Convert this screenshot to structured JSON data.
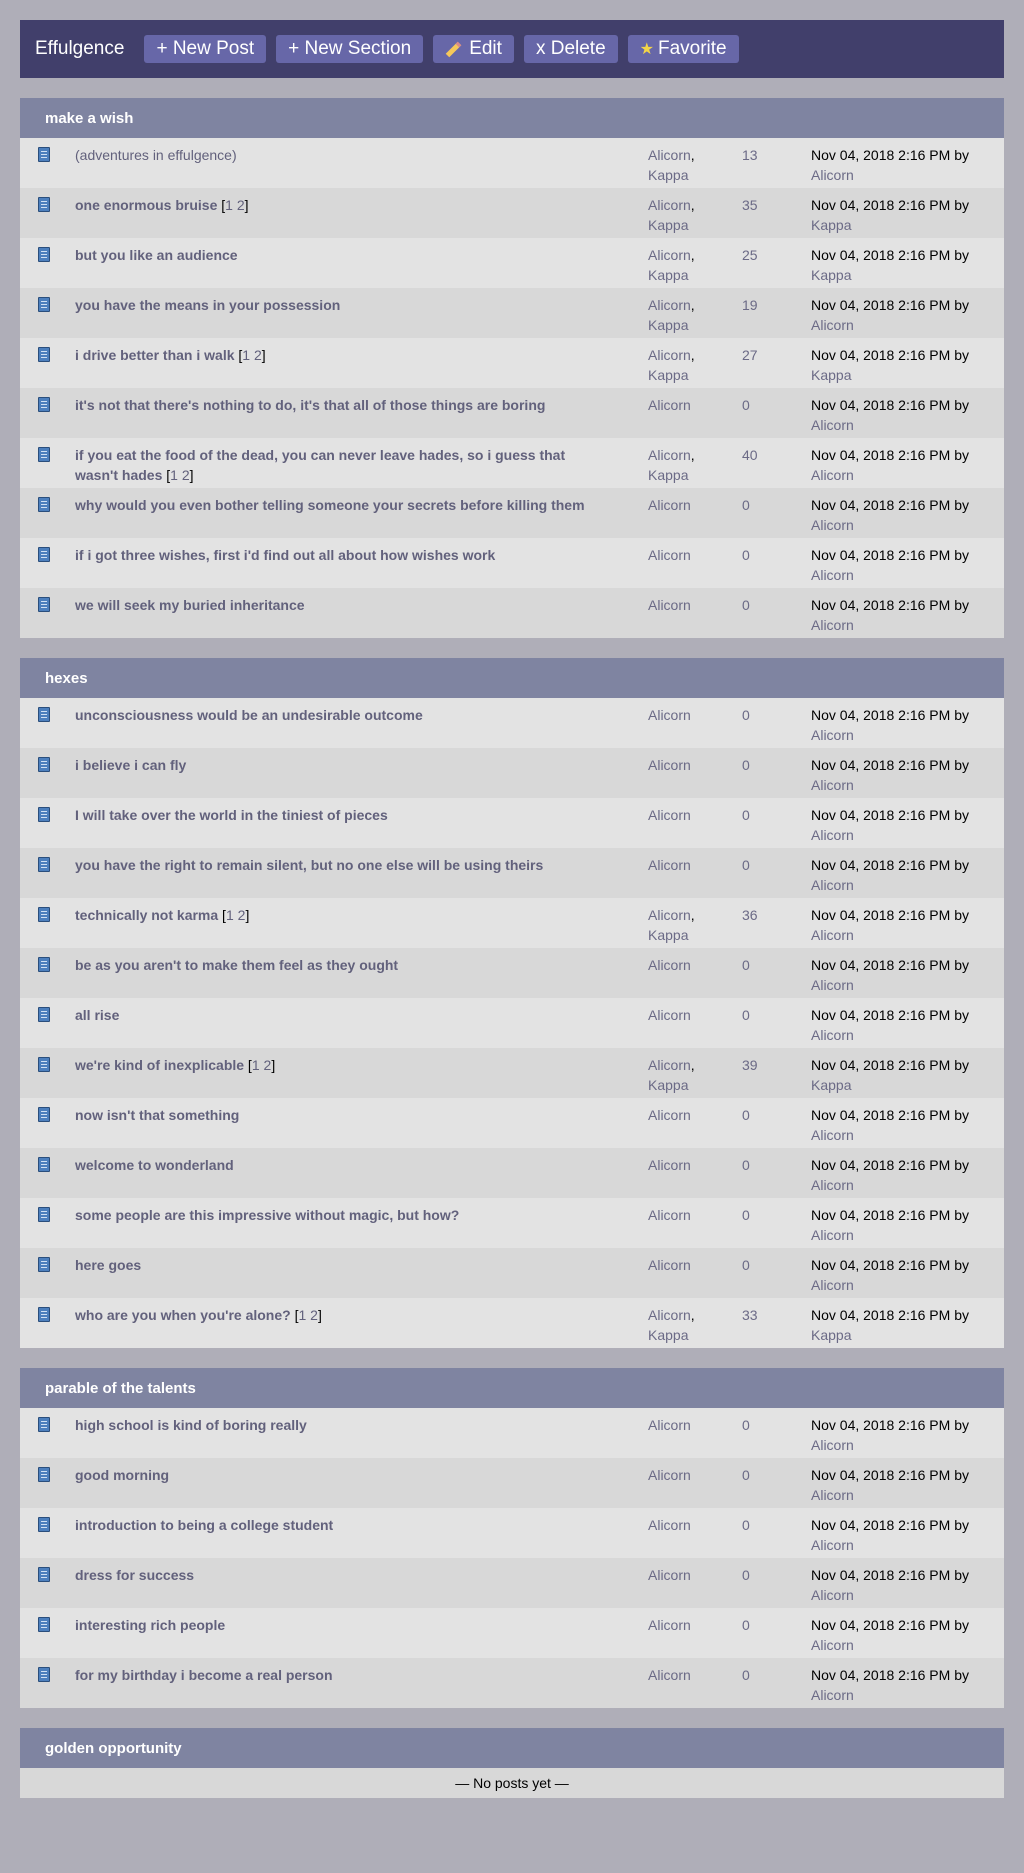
{
  "header": {
    "title": "Effulgence",
    "buttons": {
      "new_post": "+ New Post",
      "new_section": "+ New Section",
      "edit": "Edit",
      "delete": "x Delete",
      "favorite": "Favorite"
    }
  },
  "last_prefix": "Nov 04, 2018 2:16 PM by",
  "sections": [
    {
      "name": "make a wish",
      "posts": [
        {
          "title": "(adventures in effulgence)",
          "bold": false,
          "pages": false,
          "authors": [
            "Alicorn",
            "Kappa"
          ],
          "count": "13",
          "by": "Alicorn"
        },
        {
          "title": "one enormous bruise",
          "bold": true,
          "pages": true,
          "authors": [
            "Alicorn",
            "Kappa"
          ],
          "count": "35",
          "by": "Kappa"
        },
        {
          "title": "but you like an audience",
          "bold": true,
          "pages": false,
          "authors": [
            "Alicorn",
            "Kappa"
          ],
          "count": "25",
          "by": "Kappa"
        },
        {
          "title": "you have the means in your possession",
          "bold": true,
          "pages": false,
          "authors": [
            "Alicorn",
            "Kappa"
          ],
          "count": "19",
          "by": "Alicorn"
        },
        {
          "title": "i drive better than i walk",
          "bold": true,
          "pages": true,
          "authors": [
            "Alicorn",
            "Kappa"
          ],
          "count": "27",
          "by": "Kappa"
        },
        {
          "title": "it's not that there's nothing to do, it's that all of those things are boring",
          "bold": true,
          "pages": false,
          "authors": [
            "Alicorn"
          ],
          "count": "0",
          "by": "Alicorn"
        },
        {
          "title": "if you eat the food of the dead, you can never leave hades, so i guess that wasn't hades",
          "bold": true,
          "pages": true,
          "authors": [
            "Alicorn",
            "Kappa"
          ],
          "count": "40",
          "by": "Alicorn"
        },
        {
          "title": "why would you even bother telling someone your secrets before killing them",
          "bold": true,
          "pages": false,
          "authors": [
            "Alicorn"
          ],
          "count": "0",
          "by": "Alicorn"
        },
        {
          "title": "if i got three wishes, first i'd find out all about how wishes work",
          "bold": true,
          "pages": false,
          "authors": [
            "Alicorn"
          ],
          "count": "0",
          "by": "Alicorn"
        },
        {
          "title": "we will seek my buried inheritance",
          "bold": true,
          "pages": false,
          "authors": [
            "Alicorn"
          ],
          "count": "0",
          "by": "Alicorn"
        }
      ]
    },
    {
      "name": "hexes",
      "posts": [
        {
          "title": "unconsciousness would be an undesirable outcome",
          "bold": true,
          "pages": false,
          "authors": [
            "Alicorn"
          ],
          "count": "0",
          "by": "Alicorn"
        },
        {
          "title": "i believe i can fly",
          "bold": true,
          "pages": false,
          "authors": [
            "Alicorn"
          ],
          "count": "0",
          "by": "Alicorn"
        },
        {
          "title": "I will take over the world in the tiniest of pieces",
          "bold": true,
          "pages": false,
          "authors": [
            "Alicorn"
          ],
          "count": "0",
          "by": "Alicorn"
        },
        {
          "title": "you have the right to remain silent, but no one else will be using theirs",
          "bold": true,
          "pages": false,
          "authors": [
            "Alicorn"
          ],
          "count": "0",
          "by": "Alicorn"
        },
        {
          "title": "technically not karma",
          "bold": true,
          "pages": true,
          "authors": [
            "Alicorn",
            "Kappa"
          ],
          "count": "36",
          "by": "Alicorn"
        },
        {
          "title": "be as you aren't to make them feel as they ought",
          "bold": true,
          "pages": false,
          "authors": [
            "Alicorn"
          ],
          "count": "0",
          "by": "Alicorn"
        },
        {
          "title": "all rise",
          "bold": true,
          "pages": false,
          "authors": [
            "Alicorn"
          ],
          "count": "0",
          "by": "Alicorn"
        },
        {
          "title": "we're kind of inexplicable",
          "bold": true,
          "pages": true,
          "authors": [
            "Alicorn",
            "Kappa"
          ],
          "count": "39",
          "by": "Kappa"
        },
        {
          "title": "now isn't that something",
          "bold": true,
          "pages": false,
          "authors": [
            "Alicorn"
          ],
          "count": "0",
          "by": "Alicorn"
        },
        {
          "title": "welcome to wonderland",
          "bold": true,
          "pages": false,
          "authors": [
            "Alicorn"
          ],
          "count": "0",
          "by": "Alicorn"
        },
        {
          "title": "some people are this impressive without magic, but how?",
          "bold": true,
          "pages": false,
          "authors": [
            "Alicorn"
          ],
          "count": "0",
          "by": "Alicorn"
        },
        {
          "title": "here goes",
          "bold": true,
          "pages": false,
          "authors": [
            "Alicorn"
          ],
          "count": "0",
          "by": "Alicorn"
        },
        {
          "title": "who are you when you're alone?",
          "bold": true,
          "pages": true,
          "authors": [
            "Alicorn",
            "Kappa"
          ],
          "count": "33",
          "by": "Kappa"
        }
      ]
    },
    {
      "name": "parable of the talents",
      "posts": [
        {
          "title": "high school is kind of boring really",
          "bold": true,
          "pages": false,
          "authors": [
            "Alicorn"
          ],
          "count": "0",
          "by": "Alicorn"
        },
        {
          "title": "good morning",
          "bold": true,
          "pages": false,
          "authors": [
            "Alicorn"
          ],
          "count": "0",
          "by": "Alicorn"
        },
        {
          "title": "introduction to being a college student",
          "bold": true,
          "pages": false,
          "authors": [
            "Alicorn"
          ],
          "count": "0",
          "by": "Alicorn"
        },
        {
          "title": "dress for success",
          "bold": true,
          "pages": false,
          "authors": [
            "Alicorn"
          ],
          "count": "0",
          "by": "Alicorn"
        },
        {
          "title": "interesting rich people",
          "bold": true,
          "pages": false,
          "authors": [
            "Alicorn"
          ],
          "count": "0",
          "by": "Alicorn"
        },
        {
          "title": "for my birthday i become a real person",
          "bold": true,
          "pages": false,
          "authors": [
            "Alicorn"
          ],
          "count": "0",
          "by": "Alicorn"
        }
      ]
    },
    {
      "name": "golden opportunity",
      "posts": [],
      "empty_text": "— No posts yet —"
    }
  ]
}
